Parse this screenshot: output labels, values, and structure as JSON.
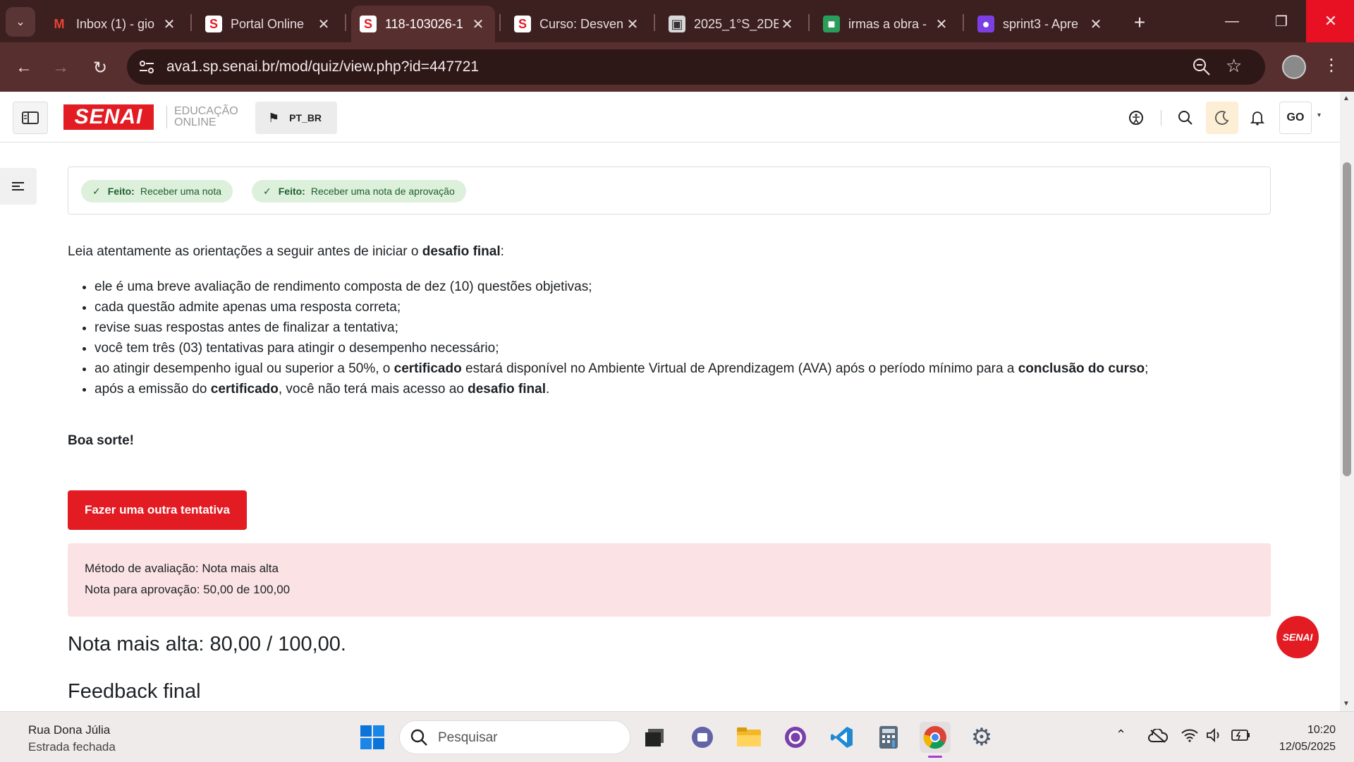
{
  "browser": {
    "tabs": [
      {
        "title": "Inbox (1) - gio",
        "favicon": "gmail-icon",
        "active": false
      },
      {
        "title": "Portal Online",
        "favicon": "senai-s-icon",
        "active": false
      },
      {
        "title": "118-103026-1",
        "favicon": "senai-s-icon",
        "active": true
      },
      {
        "title": "Curso: Desven",
        "favicon": "senai-s-icon",
        "active": false
      },
      {
        "title": "2025_1°S_2DB",
        "favicon": "classroom-icon",
        "active": false
      },
      {
        "title": "irmas a obra -",
        "favicon": "slides-icon",
        "active": false
      },
      {
        "title": "sprint3 - Apre",
        "favicon": "canva-icon",
        "active": false
      }
    ],
    "new_tab": "+",
    "url": "ava1.sp.senai.br/mod/quiz/view.php?id=447721"
  },
  "header": {
    "logo_text": "SENAI",
    "edu_line1": "EDUCAÇÃO",
    "edu_line2": "ONLINE",
    "lang": "PT_BR",
    "user_initials": "GO"
  },
  "completion": {
    "items": [
      {
        "status": "Feito:",
        "text": "Receber uma nota"
      },
      {
        "status": "Feito:",
        "text": "Receber uma nota de aprovação"
      }
    ]
  },
  "intro": {
    "prefix": "Leia atentamente as orientações a seguir antes de iniciar o ",
    "bold": "desafio final",
    "suffix": ":"
  },
  "rules": [
    {
      "parts": [
        {
          "t": "ele é uma breve avaliação de rendimento composta de dez (10) questões objetivas;",
          "b": false
        }
      ]
    },
    {
      "parts": [
        {
          "t": "cada questão admite apenas uma resposta correta;",
          "b": false
        }
      ]
    },
    {
      "parts": [
        {
          "t": "revise suas respostas antes de finalizar a tentativa;",
          "b": false
        }
      ]
    },
    {
      "parts": [
        {
          "t": "você tem três (03) tentativas para atingir o desempenho necessário;",
          "b": false
        }
      ]
    },
    {
      "parts": [
        {
          "t": "ao atingir desempenho igual ou superior a 50%, o ",
          "b": false
        },
        {
          "t": "certificado",
          "b": true
        },
        {
          "t": " estará disponível no Ambiente Virtual de Aprendizagem (AVA) após o período mínimo para a ",
          "b": false
        },
        {
          "t": "conclusão do curso",
          "b": true
        },
        {
          "t": ";",
          "b": false
        }
      ]
    },
    {
      "parts": [
        {
          "t": "após a emissão do ",
          "b": false
        },
        {
          "t": "certificado",
          "b": true
        },
        {
          "t": ", você não terá mais acesso ao ",
          "b": false
        },
        {
          "t": "desafio final",
          "b": true
        },
        {
          "t": ".",
          "b": false
        }
      ]
    }
  ],
  "good_luck": "Boa sorte!",
  "retry_button": "Fazer uma outra tentativa",
  "grading": {
    "method": "Método de avaliação: Nota mais alta",
    "pass": "Nota para aprovação: 50,00 de 100,00"
  },
  "highest_grade": "Nota mais alta: 80,00 / 100,00.",
  "feedback_title": "Feedback final",
  "float_logo": "SENAI",
  "taskbar": {
    "weather_title": "Rua Dona Júlia",
    "weather_sub": "Estrada fechada",
    "search_placeholder": "Pesquisar",
    "time": "10:20",
    "date": "12/05/2025"
  }
}
